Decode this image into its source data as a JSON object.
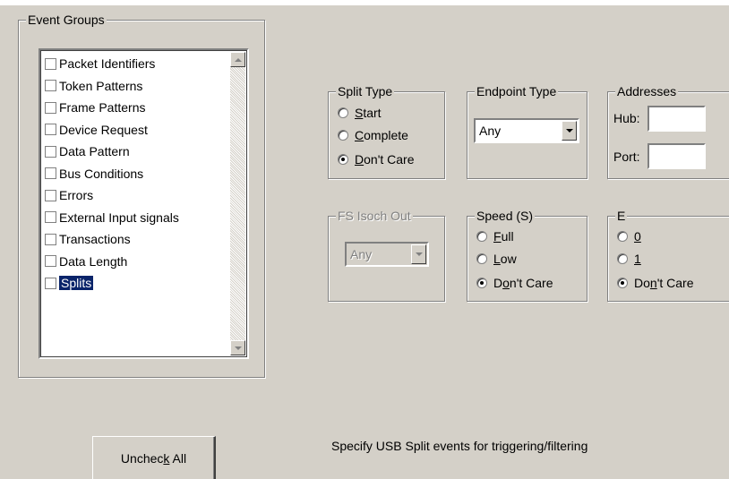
{
  "event_groups": {
    "title": "Event Groups",
    "items": [
      {
        "label": "Packet Identifiers",
        "selected": false
      },
      {
        "label": "Token Patterns",
        "selected": false
      },
      {
        "label": "Frame Patterns",
        "selected": false
      },
      {
        "label": "Device Request",
        "selected": false
      },
      {
        "label": "Data Pattern",
        "selected": false
      },
      {
        "label": "Bus Conditions",
        "selected": false
      },
      {
        "label": "Errors",
        "selected": false
      },
      {
        "label": "External Input signals",
        "selected": false
      },
      {
        "label": "Transactions",
        "selected": false
      },
      {
        "label": "Data Length",
        "selected": false
      },
      {
        "label": "Splits",
        "selected": true
      }
    ]
  },
  "split_type": {
    "title": "Split Type",
    "options": {
      "start": {
        "pre": "",
        "key": "S",
        "post": "tart"
      },
      "complete": {
        "pre": "",
        "key": "C",
        "post": "omplete"
      },
      "dont_care": {
        "pre": "",
        "key": "D",
        "post": "on't Care"
      }
    },
    "selected": "Don't Care"
  },
  "endpoint_type": {
    "title": "Endpoint Type",
    "value": "Any"
  },
  "addresses": {
    "title": "Addresses",
    "hub_label": "Hub:",
    "hub_value": "",
    "port_label": "Port:",
    "port_value": ""
  },
  "fs_isoch_out": {
    "title": "FS Isoch Out",
    "value": "Any",
    "enabled": false
  },
  "speed": {
    "title": "Speed (S)",
    "options": {
      "full": {
        "pre": "",
        "key": "F",
        "post": "ull"
      },
      "low": {
        "pre": "",
        "key": "L",
        "post": "ow"
      },
      "dont_care": {
        "pre": "D",
        "key": "o",
        "post": "n't Care"
      }
    },
    "selected": "Don't Care"
  },
  "e": {
    "title": "E",
    "options": {
      "zero": {
        "pre": "",
        "key": "0",
        "post": ""
      },
      "one": {
        "pre": "",
        "key": "1",
        "post": ""
      },
      "dont_care": {
        "pre": "Do",
        "key": "n",
        "post": "'t Care"
      }
    },
    "selected": "Don't Care"
  },
  "uncheck_all": {
    "pre": "Unchec",
    "key": "k",
    "post": " All"
  },
  "status_text": "Specify USB Split events for triggering/filtering",
  "colors": {
    "face": "#d4d0c8",
    "selection": "#0a246a"
  }
}
